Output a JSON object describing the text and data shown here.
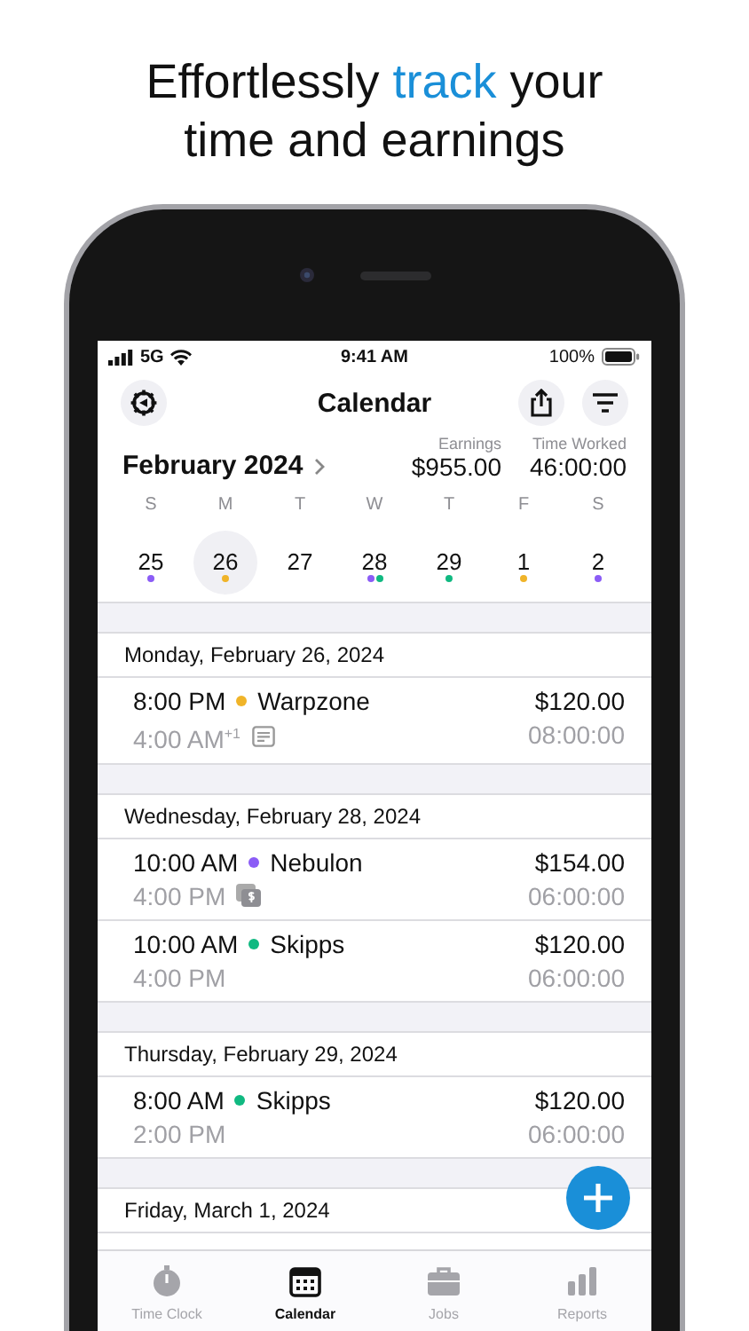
{
  "headline": {
    "lines": [
      [
        {
          "text": "Effortlessly ",
          "highlight": false
        },
        {
          "text": "track",
          "highlight": true
        },
        {
          "text": " your",
          "highlight": false
        }
      ],
      [
        {
          "text": "time and earnings",
          "highlight": false
        }
      ]
    ]
  },
  "status_bar": {
    "network": "5G",
    "time": "9:41 AM",
    "battery": "100%"
  },
  "header": {
    "title": "Calendar"
  },
  "month": {
    "label": "February 2024"
  },
  "stats": [
    {
      "label": "Earnings",
      "value": "$955.00"
    },
    {
      "label": "Time Worked",
      "value": "46:00:00"
    }
  ],
  "week": {
    "days": [
      {
        "letter": "S",
        "number": "25",
        "selected": false,
        "dots": [
          {
            "color": "#8b5cf6"
          }
        ]
      },
      {
        "letter": "M",
        "number": "26",
        "selected": true,
        "dots": [
          {
            "color": "#f0b429"
          }
        ]
      },
      {
        "letter": "T",
        "number": "27",
        "selected": false
      },
      {
        "letter": "W",
        "number": "28",
        "selected": false,
        "dots": [
          {
            "color": "#8b5cf6"
          },
          {
            "color": "#10b981"
          }
        ]
      },
      {
        "letter": "T",
        "number": "29",
        "selected": false,
        "dots": [
          {
            "color": "#10b981"
          }
        ]
      },
      {
        "letter": "F",
        "number": "1",
        "selected": false,
        "dots": [
          {
            "color": "#f0b429"
          }
        ]
      },
      {
        "letter": "S",
        "number": "2",
        "selected": false,
        "dots": [
          {
            "color": "#8b5cf6"
          }
        ]
      }
    ]
  },
  "sections": [
    {
      "date": "Monday, February 26, 2024",
      "entries": [
        {
          "start": "8:00 PM",
          "job": "Warpzone",
          "color": "#f0b429",
          "amount": "$120.00",
          "end": "4:00 AM$^{+1}$",
          "kind": "note",
          "duration": "08:00:00"
        }
      ]
    },
    {
      "date": "Wednesday, February 28, 2024",
      "entries": [
        {
          "start": "10:00 AM",
          "job": "Nebulon",
          "color": "#8b5cf6",
          "amount": "$154.00",
          "end": "4:00 PM",
          "kind": "cash",
          "duration": "06:00:00"
        },
        {
          "start": "10:00 AM",
          "job": "Skipps",
          "color": "#10b981",
          "amount": "$120.00",
          "end": "4:00 PM",
          "kind": "plain",
          "duration": "06:00:00"
        }
      ]
    },
    {
      "date": "Thursday, February 29, 2024",
      "entries": [
        {
          "start": "8:00 AM",
          "job": "Skipps",
          "color": "#10b981",
          "amount": "$120.00",
          "end": "2:00 PM",
          "kind": "plain",
          "duration": "06:00:00"
        }
      ]
    },
    {
      "date": "Friday, March 1, 2024"
    }
  ],
  "tabs": [
    {
      "label": "Time Clock",
      "selected": false
    },
    {
      "label": "Calendar",
      "selected": true
    },
    {
      "label": "Jobs",
      "selected": false
    },
    {
      "label": "Reports",
      "selected": false
    }
  ]
}
